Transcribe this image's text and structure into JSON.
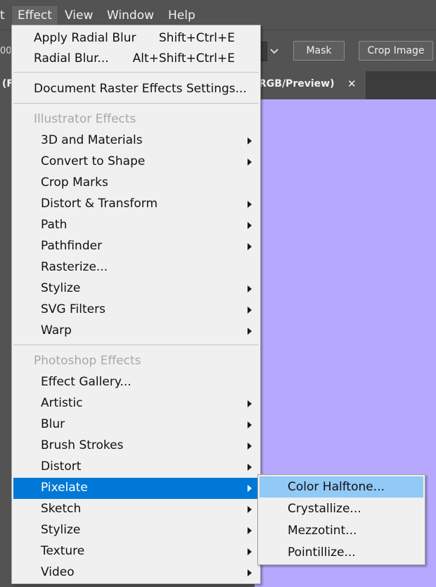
{
  "menubar": {
    "clipped_item": "t",
    "items": [
      "Effect",
      "View",
      "Window",
      "Help"
    ]
  },
  "controlbar": {
    "left_clipped": "00",
    "mask_label": "Mask",
    "crop_label": "Crop Image"
  },
  "tab": {
    "left_text": "(F",
    "right_text": "RGB/Preview)",
    "close": "✕"
  },
  "effect_menu": {
    "apply_last": {
      "label": "Apply Radial Blur",
      "shortcut": "Shift+Ctrl+E"
    },
    "last_effect": {
      "label": "Radial Blur...",
      "shortcut": "Alt+Shift+Ctrl+E"
    },
    "doc_settings": "Document Raster Effects Settings...",
    "illustrator_header": "Illustrator Effects",
    "illustrator_items": [
      "3D and Materials",
      "Convert to Shape",
      "Crop Marks",
      "Distort & Transform",
      "Path",
      "Pathfinder",
      "Rasterize...",
      "Stylize",
      "SVG Filters",
      "Warp"
    ],
    "photoshop_header": "Photoshop Effects",
    "photoshop_items": [
      "Effect Gallery...",
      "Artistic",
      "Blur",
      "Brush Strokes",
      "Distort",
      "Pixelate",
      "Sketch",
      "Stylize",
      "Texture",
      "Video"
    ]
  },
  "pixelate_submenu": [
    "Color Halftone...",
    "Crystallize...",
    "Mezzotint...",
    "Pointillize..."
  ],
  "colors": {
    "highlight": "#0078d7",
    "submenu_highlight": "#91c9f7",
    "artboard": "#b6a8ff"
  }
}
